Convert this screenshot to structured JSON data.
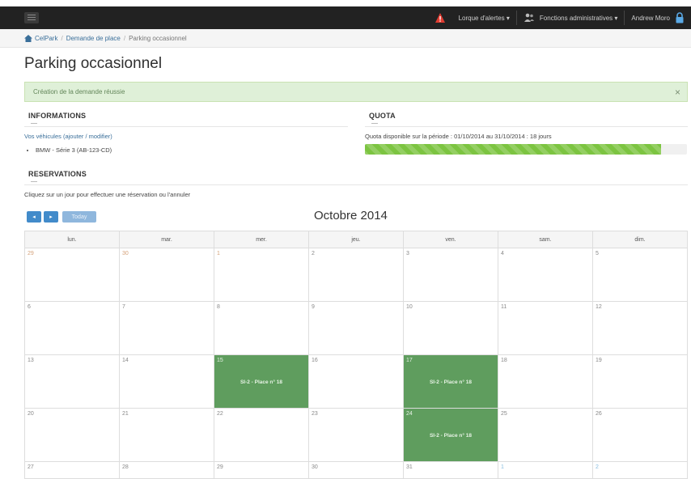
{
  "topbar": {
    "nav_items": [
      "Lorque d'alertes ▾",
      "Fonctions administratives ▾",
      "Andrew Moro"
    ]
  },
  "breadcrumb": {
    "items": [
      "CelPark",
      "Demande de place",
      "Parking occasionnel"
    ]
  },
  "page": {
    "title": "Parking occasionnel"
  },
  "alert": {
    "message": "Création de la demande réussie",
    "close": "×"
  },
  "informations": {
    "heading": "INFORMATIONS",
    "vehicles_label": "Vos véhicules (ajouter / modifier)",
    "vehicles": [
      "BMW - Série 3 (AB-123-CD)"
    ]
  },
  "quota": {
    "heading": "QUOTA",
    "text": "Quota disponible sur la période : 01/10/2014 au 31/10/2014 : 18 jours",
    "progress_percent": 92
  },
  "reservations": {
    "heading": "RESERVATIONS",
    "hint": "Cliquez sur un jour pour effectuer une réservation ou l'annuler"
  },
  "calendar": {
    "prev_label": "◂",
    "next_label": "▸",
    "today_label": "Today",
    "title": "Octobre 2014",
    "weekdays": [
      "lun.",
      "mar.",
      "mer.",
      "jeu.",
      "ven.",
      "sam.",
      "dim."
    ],
    "weeks": [
      [
        {
          "d": "29",
          "m": "prev"
        },
        {
          "d": "30",
          "m": "prev"
        },
        {
          "d": "1",
          "m": "cur"
        },
        {
          "d": "2",
          "m": "cur"
        },
        {
          "d": "3",
          "m": "cur"
        },
        {
          "d": "4",
          "m": "cur"
        },
        {
          "d": "5",
          "m": "cur"
        }
      ],
      [
        {
          "d": "6",
          "m": "cur"
        },
        {
          "d": "7",
          "m": "cur"
        },
        {
          "d": "8",
          "m": "cur"
        },
        {
          "d": "9",
          "m": "cur"
        },
        {
          "d": "10",
          "m": "cur"
        },
        {
          "d": "11",
          "m": "cur"
        },
        {
          "d": "12",
          "m": "cur"
        }
      ],
      [
        {
          "d": "13",
          "m": "cur"
        },
        {
          "d": "14",
          "m": "cur"
        },
        {
          "d": "15",
          "m": "cur",
          "event": "SI-2 - Place n° 18"
        },
        {
          "d": "16",
          "m": "cur"
        },
        {
          "d": "17",
          "m": "cur",
          "event": "SI-2 - Place n° 18"
        },
        {
          "d": "18",
          "m": "cur"
        },
        {
          "d": "19",
          "m": "cur"
        }
      ],
      [
        {
          "d": "20",
          "m": "cur"
        },
        {
          "d": "21",
          "m": "cur"
        },
        {
          "d": "22",
          "m": "cur"
        },
        {
          "d": "23",
          "m": "cur"
        },
        {
          "d": "24",
          "m": "cur",
          "event": "SI-2 - Place n° 18"
        },
        {
          "d": "25",
          "m": "cur"
        },
        {
          "d": "26",
          "m": "cur"
        }
      ],
      [
        {
          "d": "27",
          "m": "cur"
        },
        {
          "d": "28",
          "m": "cur"
        },
        {
          "d": "29",
          "m": "cur"
        },
        {
          "d": "30",
          "m": "cur"
        },
        {
          "d": "31",
          "m": "cur"
        },
        {
          "d": "1",
          "m": "next"
        },
        {
          "d": "2",
          "m": "next"
        }
      ]
    ]
  },
  "colors": {
    "topbar": "#222222",
    "warning": "#e03c31",
    "event": "#5f9d5e",
    "progress": "#7cc441",
    "primary": "#428bca"
  }
}
